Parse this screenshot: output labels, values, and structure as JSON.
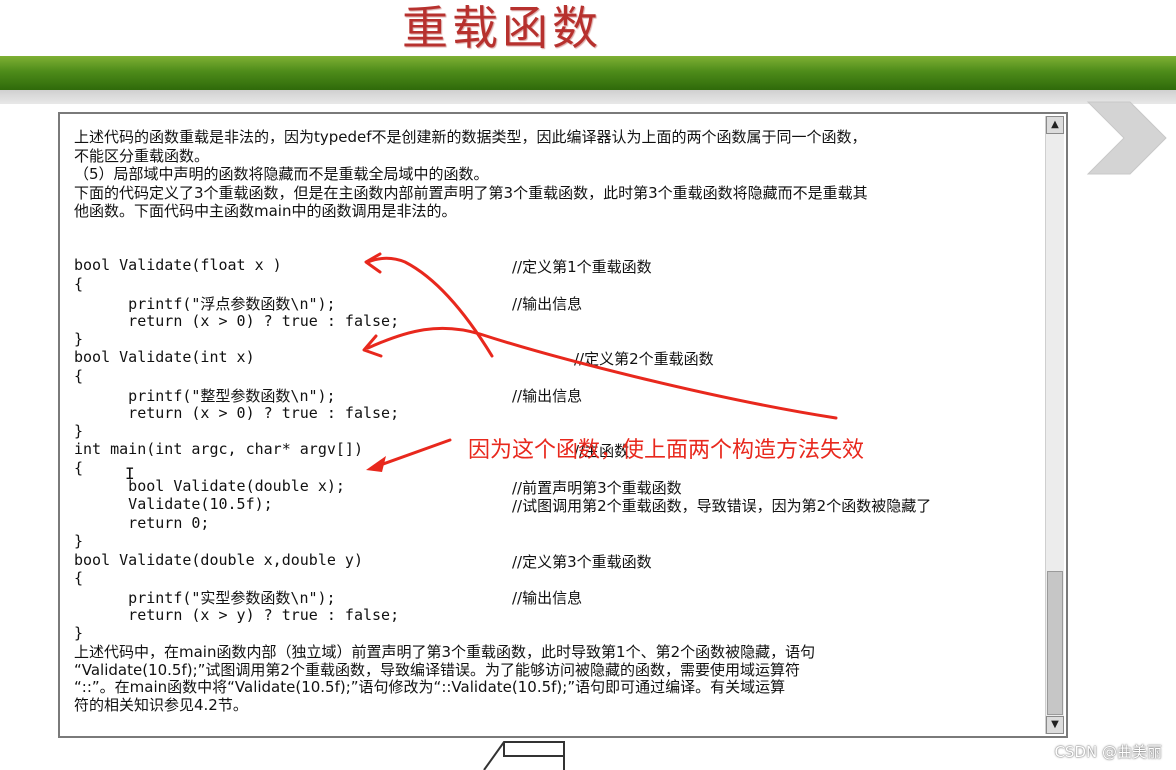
{
  "slide": {
    "title": "重载函数"
  },
  "document": {
    "intro_lines": [
      "上述代码的函数重载是非法的，因为typedef不是创建新的数据类型，因此编译器认为上面的两个函数属于同一个函数，",
      "不能区分重载函数。",
      "（5）局部域中声明的函数将隐藏而不是重载全局域中的函数。",
      "下面的代码定义了3个重载函数，但是在主函数内部前置声明了第3个重载函数，此时第3个重载函数将隐藏而不是重载其",
      "他函数。下面代码中主函数main中的函数调用是非法的。"
    ],
    "code_lines": [
      {
        "code": "",
        "comment": ""
      },
      {
        "code": "bool Validate(float x )",
        "comment": "//定义第1个重载函数"
      },
      {
        "code": "{",
        "comment": ""
      },
      {
        "code": "      printf(\"浮点参数函数\\n\");",
        "comment": "//输出信息"
      },
      {
        "code": "      return (x > 0) ? true : false;",
        "comment": ""
      },
      {
        "code": "}",
        "comment": ""
      },
      {
        "code": "bool Validate(int x)",
        "comment": "//定义第2个重载函数"
      },
      {
        "code": "{",
        "comment": ""
      },
      {
        "code": "      printf(\"整型参数函数\\n\");",
        "comment": "//输出信息"
      },
      {
        "code": "      return (x > 0) ? true : false;",
        "comment": ""
      },
      {
        "code": "}",
        "comment": ""
      },
      {
        "code": "int main(int argc, char* argv[])",
        "comment": "//主函数"
      },
      {
        "code": "{",
        "comment": ""
      },
      {
        "code": "      bool Validate(double x);",
        "comment": "//前置声明第3个重载函数"
      },
      {
        "code": "      Validate(10.5f);",
        "comment": "//试图调用第2个重载函数，导致错误，因为第2个函数被隐藏了"
      },
      {
        "code": "      return 0;",
        "comment": ""
      },
      {
        "code": "}",
        "comment": ""
      },
      {
        "code": "bool Validate(double x,double y)",
        "comment": "//定义第3个重载函数"
      },
      {
        "code": "{",
        "comment": ""
      },
      {
        "code": "      printf(\"实型参数函数\\n\");",
        "comment": "//输出信息"
      },
      {
        "code": "      return (x > y) ? true : false;",
        "comment": ""
      },
      {
        "code": "}",
        "comment": ""
      }
    ],
    "outro_lines": [
      "上述代码中，在main函数内部（独立域）前置声明了第3个重载函数，此时导致第1个、第2个函数被隐藏，语句",
      "“Validate(10.5f);”试图调用第2个重载函数，导致编译错误。为了能够访问被隐藏的函数，需要使用域运算符",
      "“::”。在main函数中将“Validate(10.5f);”语句修改为“::Validate(10.5f);”语句即可通过编译。有关域运算",
      "符的相关知识参见4.2节。"
    ]
  },
  "annotation": {
    "note": "因为这个函数，使上面两个构造方法失效",
    "color": "#e8281d"
  },
  "scrollbar": {
    "up_glyph": "▲",
    "down_glyph": "▼"
  },
  "watermark": "CSDN @曲美丽",
  "colors": {
    "title": "#b7312e",
    "green_bar": "#4e8c1a",
    "annotation": "#e8281d"
  }
}
